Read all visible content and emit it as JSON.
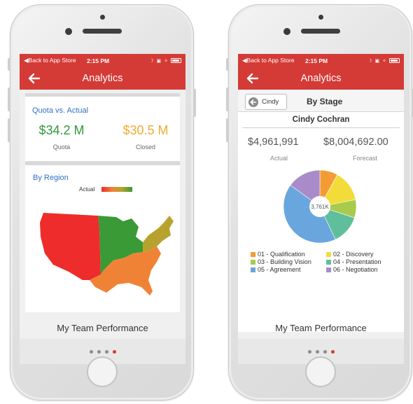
{
  "status_bar": {
    "back_label": "◀Back to App Store",
    "time": "2:15 PM"
  },
  "nav": {
    "title": "Analytics"
  },
  "left_screen": {
    "quota_section_title": "Quota vs. Actual",
    "quota_value": "$34.2 M",
    "quota_label": "Quota",
    "closed_value": "$30.5 M",
    "closed_label": "Closed",
    "region_section_title": "By Region",
    "region_legend_label": "Actual",
    "footer_title": "My Team Performance",
    "page_count": 4,
    "active_page": 4
  },
  "right_screen": {
    "back_button_label": "Cindy",
    "section_title": "By Stage",
    "person_name": "Cindy Cochran",
    "actual_value": "$4,961,991",
    "actual_label": "Actual",
    "forecast_value": "$8,004,692.00",
    "forecast_label": "Forecast",
    "donut_center_label": "3,761K",
    "footer_title": "My Team Performance",
    "page_count": 4,
    "active_page": 4
  },
  "chart_data": {
    "type": "pie",
    "center_label": "3,761K",
    "categories": [
      "01 - Qualification",
      "02 - Discovery",
      "03 - Building Vision",
      "04 - Presentation",
      "05 - Agreement",
      "06 - Negotiation"
    ],
    "values": [
      8,
      14,
      8,
      13,
      42,
      15
    ],
    "colors": [
      "#f39c34",
      "#f2dc3a",
      "#a9cb4d",
      "#5fbf9c",
      "#6aa6de",
      "#a98bc9"
    ]
  },
  "colors": {
    "brand_red": "#d43a36",
    "quota_green": "#2e9a3a",
    "closed_orange": "#f2a931",
    "link_blue": "#2f72c4",
    "region_red": "#ee2c2c",
    "region_green": "#3a9a35",
    "region_orange": "#f08236",
    "region_olive": "#b8a22e"
  }
}
